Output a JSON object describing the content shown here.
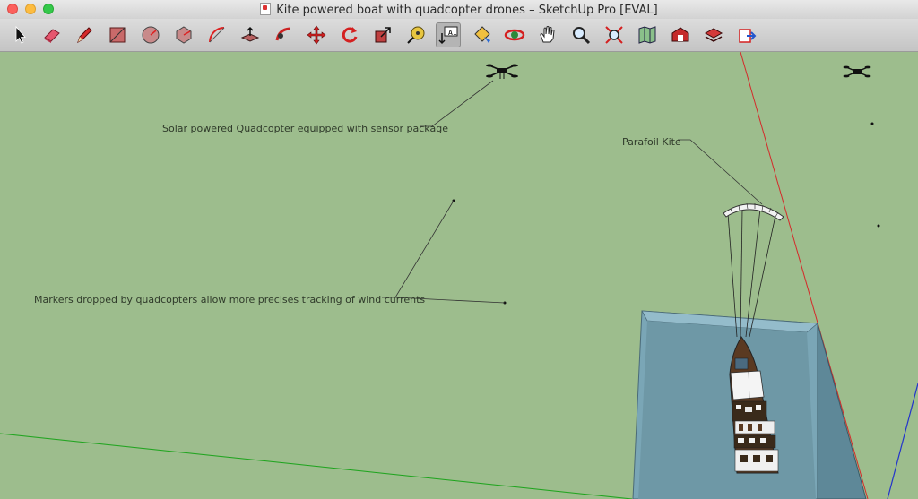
{
  "window": {
    "title": "Kite powered boat with quadcopter drones – SketchUp Pro [EVAL]"
  },
  "toolbar": {
    "tools": [
      {
        "name": "select-tool",
        "icon": "arrow-cursor-icon"
      },
      {
        "name": "eraser-tool",
        "icon": "eraser-icon"
      },
      {
        "name": "pencil-tool",
        "icon": "pencil-icon"
      },
      {
        "name": "rectangle-tool",
        "icon": "rectangle-icon"
      },
      {
        "name": "circle-tool",
        "icon": "circle-icon"
      },
      {
        "name": "polygon-tool",
        "icon": "polygon-icon"
      },
      {
        "name": "arc-tool",
        "icon": "arc-icon"
      },
      {
        "name": "push-pull-tool",
        "icon": "push-pull-icon"
      },
      {
        "name": "follow-me-tool",
        "icon": "follow-me-icon"
      },
      {
        "name": "move-tool",
        "icon": "move-icon"
      },
      {
        "name": "rotate-tool",
        "icon": "rotate-icon"
      },
      {
        "name": "scale-tool",
        "icon": "scale-icon"
      },
      {
        "name": "tape-measure-tool",
        "icon": "tape-measure-icon"
      },
      {
        "name": "text-tool",
        "icon": "text-label-icon",
        "label": "A1",
        "pressed": true
      },
      {
        "name": "paint-bucket-tool",
        "icon": "paint-bucket-icon"
      },
      {
        "name": "orbit-tool",
        "icon": "orbit-icon"
      },
      {
        "name": "pan-tool",
        "icon": "hand-icon"
      },
      {
        "name": "zoom-tool",
        "icon": "magnifier-icon"
      },
      {
        "name": "zoom-extents-tool",
        "icon": "zoom-extents-icon"
      },
      {
        "name": "previous-view-tool",
        "icon": "map-view-icon"
      },
      {
        "name": "get-models-tool",
        "icon": "warehouse-icon"
      },
      {
        "name": "share-model-tool",
        "icon": "share-model-icon"
      },
      {
        "name": "share-component-tool",
        "icon": "share-component-icon"
      },
      {
        "name": "extension-warehouse-tool",
        "icon": "extension-icon"
      }
    ]
  },
  "annotations": {
    "quadcopter": "Solar powered Quadcopter equipped with sensor package",
    "kite": "Parafoil Kite",
    "markers": "Markers dropped by quadcopters allow more precises tracking of wind currents"
  },
  "colors": {
    "background": "#9dbd8d",
    "red_axis": "#d42a2a",
    "green_axis": "#1aa31a",
    "blue_axis": "#2233cc",
    "water": "#6e98a6",
    "boat_hull": "#5a3a22"
  }
}
